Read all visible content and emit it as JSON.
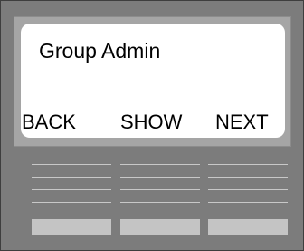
{
  "display": {
    "title": "Group Admin"
  },
  "softkeys": {
    "back": "BACK",
    "show": "SHOW",
    "next": "NEXT"
  },
  "colors": {
    "housing": "#7c7c7c",
    "bezel": "#a5a5a5",
    "screen": "#ffffff",
    "key_lines": "#c8c8c8",
    "key_buttons": "#c4c4c4"
  }
}
